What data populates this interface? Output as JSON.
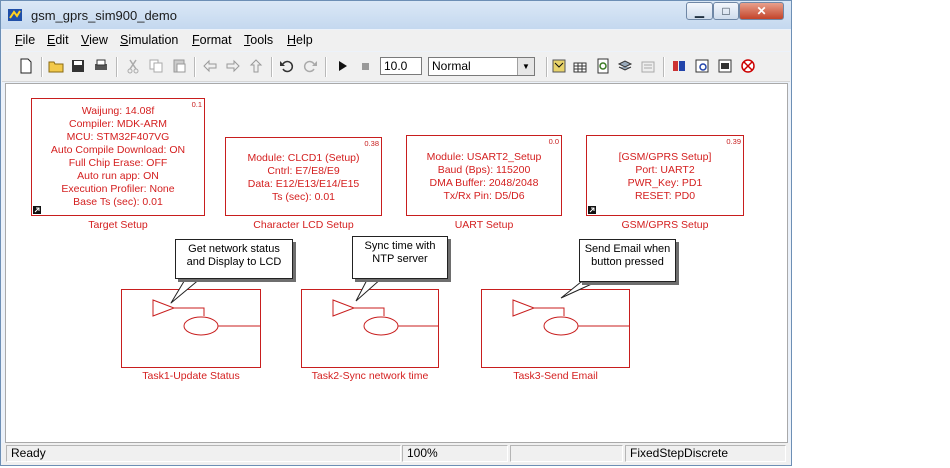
{
  "window": {
    "title": "gsm_gprs_sim900_demo"
  },
  "menubar": [
    {
      "key": "F",
      "rest": "ile"
    },
    {
      "key": "E",
      "rest": "dit"
    },
    {
      "key": "V",
      "rest": "iew"
    },
    {
      "key": "S",
      "rest": "imulation"
    },
    {
      "key": "F",
      "rest": "ormat"
    },
    {
      "key": "T",
      "rest": "ools"
    },
    {
      "key": "H",
      "rest": "elp"
    }
  ],
  "toolbar": {
    "stop_time": "10.0",
    "sim_mode": "Normal"
  },
  "blocks": {
    "target": {
      "tag": "0.1",
      "label": "Target Setup",
      "lines": [
        "Waijung: 14.08f",
        "Compiler: MDK-ARM",
        "MCU: STM32F407VG",
        "Auto Compile Download: ON",
        "Full Chip Erase: OFF",
        "Auto run app: ON",
        "Execution Profiler: None",
        "Base Ts (sec): 0.01"
      ]
    },
    "lcd": {
      "tag": "0.38",
      "label": "Character LCD Setup",
      "lines": [
        "Module: CLCD1 (Setup)",
        "Cntrl: E7/E8/E9",
        "Data: E12/E13/E14/E15",
        "Ts (sec): 0.01"
      ]
    },
    "uart": {
      "tag": "0.0",
      "label": "UART Setup",
      "lines": [
        "Module: USART2_Setup",
        "Baud (Bps): 115200",
        "DMA Buffer: 2048/2048",
        "Tx/Rx Pin: D5/D6"
      ]
    },
    "gsm": {
      "tag": "0.39",
      "label": "GSM/GPRS Setup",
      "lines": [
        "[GSM/GPRS Setup]",
        "Port: UART2",
        "PWR_Key: PD1",
        "RESET: PD0"
      ]
    }
  },
  "tasks": [
    {
      "label": "Task1-Update Status",
      "callout": [
        "Get network status",
        "and Display to LCD"
      ]
    },
    {
      "label": "Task2-Sync network time",
      "callout": [
        "Sync time with",
        "NTP server"
      ]
    },
    {
      "label": "Task3-Send Email",
      "callout": [
        "Send Email when",
        "button pressed"
      ]
    }
  ],
  "statusbar": {
    "status": "Ready",
    "zoom": "100%",
    "solver": "FixedStepDiscrete"
  }
}
